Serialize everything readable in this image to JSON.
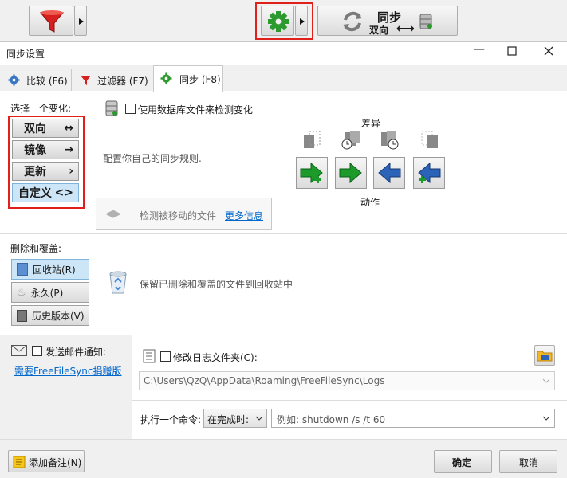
{
  "toolbar": {
    "sync_label": "同步",
    "sync_sub": "双向"
  },
  "dialog": {
    "title": "同步设置",
    "tabs": [
      {
        "label": "比较 (F6)"
      },
      {
        "label": "过滤器 (F7)"
      },
      {
        "label": "同步 (F8)"
      }
    ],
    "variant": {
      "heading": "选择一个变化:",
      "options": [
        {
          "label": "双向",
          "symbol": "↔"
        },
        {
          "label": "镜像",
          "symbol": "→"
        },
        {
          "label": "更新",
          "symbol": "›"
        },
        {
          "label": "自定义",
          "symbol": "<>"
        }
      ],
      "selected": "自定义",
      "db_checkbox_label": "使用数据库文件来检测变化",
      "description": "配置你自己的同步规则.",
      "detect_moved_label": "检测被移动的文件",
      "more_info_link": "更多信息"
    },
    "diff": {
      "heading": "差异",
      "action_heading": "动作"
    },
    "deletion": {
      "heading": "删除和覆盖:",
      "options": [
        {
          "label": "回收站(R)"
        },
        {
          "label": "永久(P)"
        },
        {
          "label": "历史版本(V)"
        }
      ],
      "selected": "回收站(R)",
      "description": "保留已删除和覆盖的文件到回收站中"
    },
    "email": {
      "label": "发送邮件通知:",
      "link": "需要FreeFileSync捐赠版"
    },
    "log": {
      "label": "修改日志文件夹(C):",
      "path": "C:\\Users\\QzQ\\AppData\\Roaming\\FreeFileSync\\Logs"
    },
    "command": {
      "label": "执行一个命令:",
      "when": "在完成时:",
      "placeholder": "例如: shutdown /s /t 60"
    },
    "footer": {
      "add_note": "添加备注(N)",
      "ok": "确定",
      "cancel": "取消"
    }
  },
  "colors": {
    "accent_red": "#e0201a",
    "selected_bg": "#cde6f7",
    "link": "#0066cc",
    "arrow_green": "#1c9b2a",
    "arrow_blue": "#2a63b8"
  }
}
